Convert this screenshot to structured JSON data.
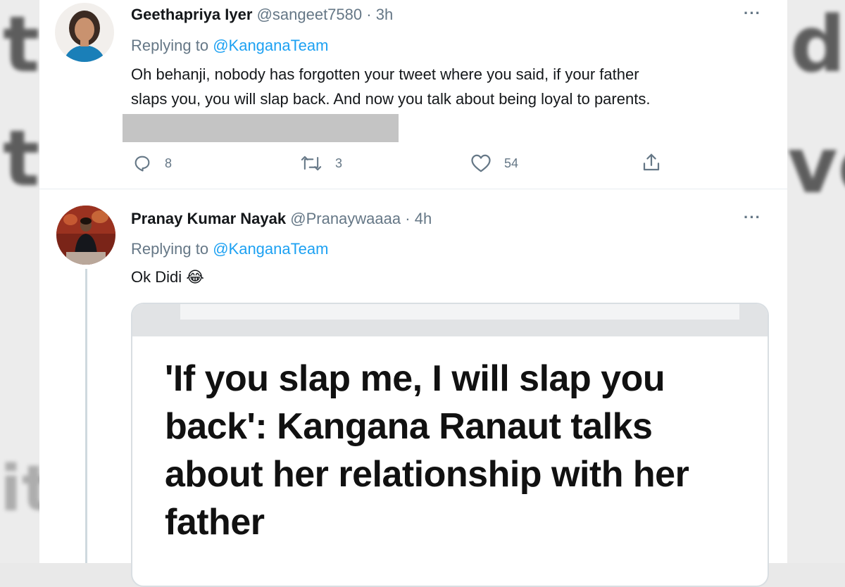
{
  "background_letters": [
    "t",
    "t",
    "it",
    "d",
    "ve"
  ],
  "tweets": [
    {
      "name": "Geethapriya Iyer",
      "handle": "@sangeet7580",
      "separator": "·",
      "time": "3h",
      "replying_prefix": "Replying to",
      "replying_to": "@KanganaTeam",
      "text_line1": "Oh behanji, nobody has forgotten your tweet where you said, if your father",
      "text_line2": "slaps you, you will slap back. And now you talk about being loyal to parents.",
      "more": "···",
      "replies": "8",
      "retweets": "3",
      "likes": "54"
    },
    {
      "name": "Pranay Kumar Nayak",
      "handle": "@Pranaywaaaa",
      "separator": "·",
      "time": "4h",
      "replying_prefix": "Replying to",
      "replying_to": "@KanganaTeam",
      "text": "Ok Didi",
      "emoji": "😂",
      "more": "···",
      "embed_headline": "'If you slap me, I will slap you back': Kangana Ranaut talks about her relationship with her father"
    }
  ],
  "colors": {
    "link": "#1da1f2",
    "muted": "#657786",
    "text": "#14171a"
  },
  "icons": [
    "reply-icon",
    "retweet-icon",
    "like-icon",
    "share-icon",
    "more-icon"
  ]
}
